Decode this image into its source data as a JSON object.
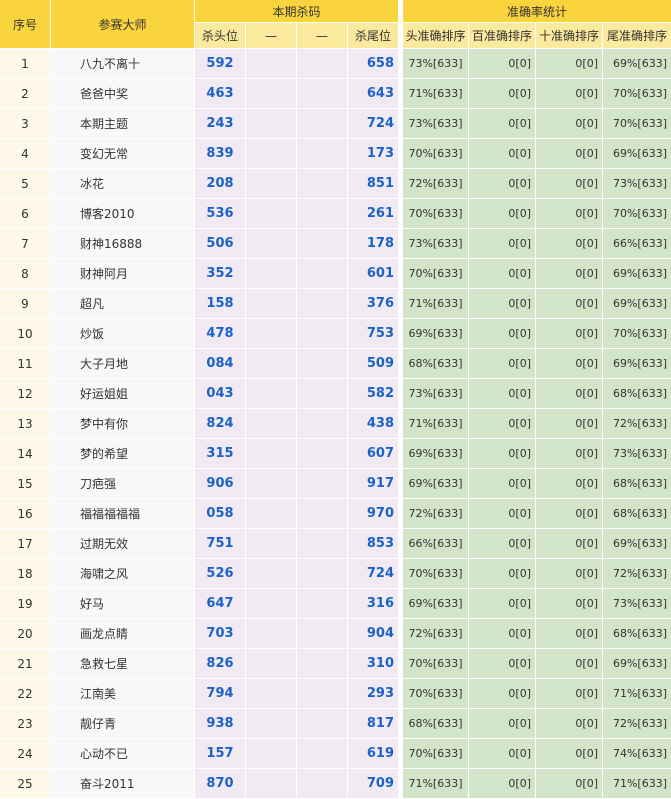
{
  "header": {
    "col_index": "序号",
    "col_master": "参赛大师",
    "group_kill": "本期杀码",
    "group_accuracy": "准确率统计",
    "sub_kill_head": "杀头位",
    "sub_dash1": "—",
    "sub_dash2": "—",
    "sub_kill_tail": "杀尾位",
    "sub_head_acc": "头准确排序",
    "sub_hundred_acc": "百准确排序",
    "sub_ten_acc": "十准确排序",
    "sub_tail_acc": "尾准确排序"
  },
  "rows": [
    {
      "idx": "1",
      "name": "八九不离十",
      "kill_head": "592",
      "kill_tail": "658",
      "head_acc": "73%[633]",
      "hundred_acc": "0[0]",
      "ten_acc": "0[0]",
      "tail_acc": "69%[633]"
    },
    {
      "idx": "2",
      "name": "爸爸中奖",
      "kill_head": "463",
      "kill_tail": "643",
      "head_acc": "71%[633]",
      "hundred_acc": "0[0]",
      "ten_acc": "0[0]",
      "tail_acc": "70%[633]"
    },
    {
      "idx": "3",
      "name": "本期主题",
      "kill_head": "243",
      "kill_tail": "724",
      "head_acc": "73%[633]",
      "hundred_acc": "0[0]",
      "ten_acc": "0[0]",
      "tail_acc": "70%[633]"
    },
    {
      "idx": "4",
      "name": "变幻无常",
      "kill_head": "839",
      "kill_tail": "173",
      "head_acc": "70%[633]",
      "hundred_acc": "0[0]",
      "ten_acc": "0[0]",
      "tail_acc": "69%[633]"
    },
    {
      "idx": "5",
      "name": "冰花",
      "kill_head": "208",
      "kill_tail": "851",
      "head_acc": "72%[633]",
      "hundred_acc": "0[0]",
      "ten_acc": "0[0]",
      "tail_acc": "73%[633]"
    },
    {
      "idx": "6",
      "name": "博客2010",
      "kill_head": "536",
      "kill_tail": "261",
      "head_acc": "70%[633]",
      "hundred_acc": "0[0]",
      "ten_acc": "0[0]",
      "tail_acc": "70%[633]"
    },
    {
      "idx": "7",
      "name": "财神16888",
      "kill_head": "506",
      "kill_tail": "178",
      "head_acc": "73%[633]",
      "hundred_acc": "0[0]",
      "ten_acc": "0[0]",
      "tail_acc": "66%[633]"
    },
    {
      "idx": "8",
      "name": "财神阿月",
      "kill_head": "352",
      "kill_tail": "601",
      "head_acc": "70%[633]",
      "hundred_acc": "0[0]",
      "ten_acc": "0[0]",
      "tail_acc": "69%[633]"
    },
    {
      "idx": "9",
      "name": "超凡",
      "kill_head": "158",
      "kill_tail": "376",
      "head_acc": "71%[633]",
      "hundred_acc": "0[0]",
      "ten_acc": "0[0]",
      "tail_acc": "69%[633]"
    },
    {
      "idx": "10",
      "name": "炒饭",
      "kill_head": "478",
      "kill_tail": "753",
      "head_acc": "69%[633]",
      "hundred_acc": "0[0]",
      "ten_acc": "0[0]",
      "tail_acc": "70%[633]"
    },
    {
      "idx": "11",
      "name": "大子月地",
      "kill_head": "084",
      "kill_tail": "509",
      "head_acc": "68%[633]",
      "hundred_acc": "0[0]",
      "ten_acc": "0[0]",
      "tail_acc": "69%[633]"
    },
    {
      "idx": "12",
      "name": "好运姐姐",
      "kill_head": "043",
      "kill_tail": "582",
      "head_acc": "73%[633]",
      "hundred_acc": "0[0]",
      "ten_acc": "0[0]",
      "tail_acc": "68%[633]"
    },
    {
      "idx": "13",
      "name": "梦中有你",
      "kill_head": "824",
      "kill_tail": "438",
      "head_acc": "71%[633]",
      "hundred_acc": "0[0]",
      "ten_acc": "0[0]",
      "tail_acc": "72%[633]"
    },
    {
      "idx": "14",
      "name": "梦的希望",
      "kill_head": "315",
      "kill_tail": "607",
      "head_acc": "69%[633]",
      "hundred_acc": "0[0]",
      "ten_acc": "0[0]",
      "tail_acc": "73%[633]"
    },
    {
      "idx": "15",
      "name": "刀疤强",
      "kill_head": "906",
      "kill_tail": "917",
      "head_acc": "69%[633]",
      "hundred_acc": "0[0]",
      "ten_acc": "0[0]",
      "tail_acc": "68%[633]"
    },
    {
      "idx": "16",
      "name": "福福福福福",
      "kill_head": "058",
      "kill_tail": "970",
      "head_acc": "72%[633]",
      "hundred_acc": "0[0]",
      "ten_acc": "0[0]",
      "tail_acc": "68%[633]"
    },
    {
      "idx": "17",
      "name": "过期无效",
      "kill_head": "751",
      "kill_tail": "853",
      "head_acc": "66%[633]",
      "hundred_acc": "0[0]",
      "ten_acc": "0[0]",
      "tail_acc": "69%[633]"
    },
    {
      "idx": "18",
      "name": "海啸之风",
      "kill_head": "526",
      "kill_tail": "724",
      "head_acc": "70%[633]",
      "hundred_acc": "0[0]",
      "ten_acc": "0[0]",
      "tail_acc": "72%[633]"
    },
    {
      "idx": "19",
      "name": "好马",
      "kill_head": "647",
      "kill_tail": "316",
      "head_acc": "69%[633]",
      "hundred_acc": "0[0]",
      "ten_acc": "0[0]",
      "tail_acc": "73%[633]"
    },
    {
      "idx": "20",
      "name": "画龙点睛",
      "kill_head": "703",
      "kill_tail": "904",
      "head_acc": "72%[633]",
      "hundred_acc": "0[0]",
      "ten_acc": "0[0]",
      "tail_acc": "68%[633]"
    },
    {
      "idx": "21",
      "name": "急救七星",
      "kill_head": "826",
      "kill_tail": "310",
      "head_acc": "70%[633]",
      "hundred_acc": "0[0]",
      "ten_acc": "0[0]",
      "tail_acc": "69%[633]"
    },
    {
      "idx": "22",
      "name": "江南美",
      "kill_head": "794",
      "kill_tail": "293",
      "head_acc": "70%[633]",
      "hundred_acc": "0[0]",
      "ten_acc": "0[0]",
      "tail_acc": "71%[633]"
    },
    {
      "idx": "23",
      "name": "靓仔青",
      "kill_head": "938",
      "kill_tail": "817",
      "head_acc": "68%[633]",
      "hundred_acc": "0[0]",
      "ten_acc": "0[0]",
      "tail_acc": "72%[633]"
    },
    {
      "idx": "24",
      "name": "心动不已",
      "kill_head": "157",
      "kill_tail": "619",
      "head_acc": "70%[633]",
      "hundred_acc": "0[0]",
      "ten_acc": "0[0]",
      "tail_acc": "74%[633]"
    },
    {
      "idx": "25",
      "name": "奋斗2011",
      "kill_head": "870",
      "kill_tail": "709",
      "head_acc": "71%[633]",
      "hundred_acc": "0[0]",
      "ten_acc": "0[0]",
      "tail_acc": "71%[633]"
    }
  ],
  "colors": {
    "header": "#f9d43c",
    "subheader": "#fbea9d",
    "index_cell": "#fdf8e7",
    "name_cell": "#f8f8f8",
    "kill_cell": "#f2eaf3",
    "accuracy_cell": "#d3e5c9",
    "kill_number": "#1a62c8"
  }
}
